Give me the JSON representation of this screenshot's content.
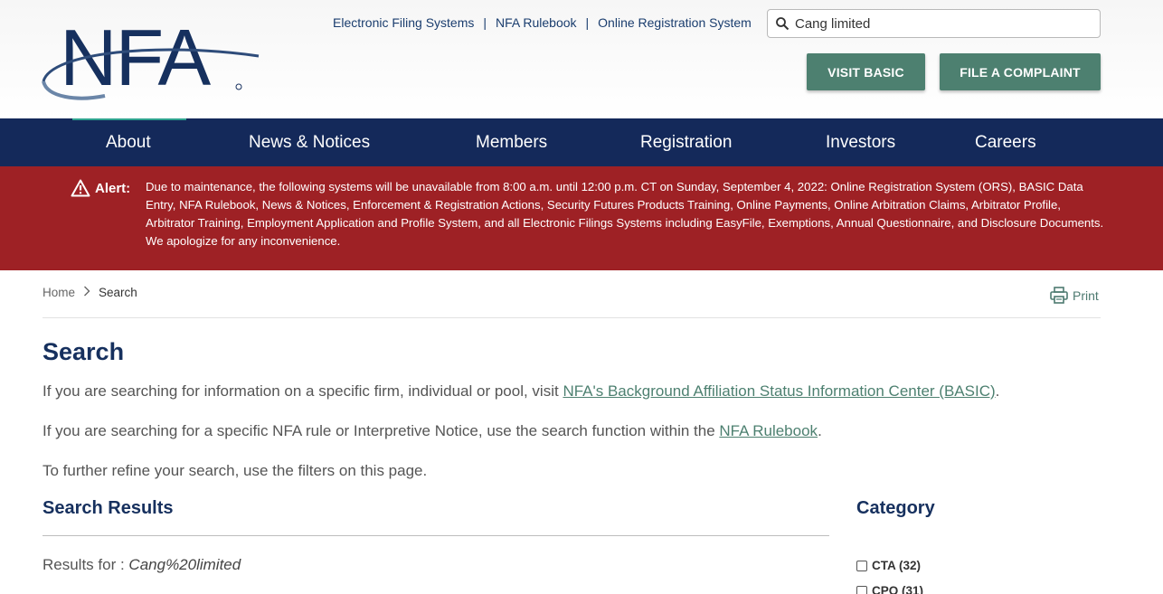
{
  "header": {
    "logo_text": "NFA",
    "top_links": [
      "Electronic Filing Systems",
      "NFA Rulebook",
      "Online Registration System"
    ],
    "search_value": "Cang limited",
    "visit_basic_label": "VISIT BASIC",
    "file_complaint_label": "FILE A COMPLAINT"
  },
  "nav": {
    "items": [
      "About",
      "News & Notices",
      "Members",
      "Registration",
      "Investors",
      "Careers"
    ]
  },
  "alert": {
    "label": "Alert:",
    "message": "Due to maintenance, the following systems will be unavailable from 8:00 a.m. until 12:00 p.m. CT on Sunday, September 4, 2022: Online Registration System (ORS), BASIC Data Entry, NFA Rulebook, News & Notices, Enforcement & Registration Actions, Security Futures Products Training, Online Payments, Online Arbitration Claims, Arbitrator Profile, Arbitrator Training, Employment Application and Profile System, and all Electronic Filings Systems including EasyFile, Exemptions, Annual Questionnaire, and Disclosure Documents. We apologize for any inconvenience."
  },
  "breadcrumb": {
    "home": "Home",
    "current": "Search"
  },
  "print_label": "Print",
  "page": {
    "title": "Search",
    "p1_text": "If you are searching for information on a specific firm, individual or pool, visit ",
    "p1_link": "NFA's Background Affiliation Status Information Center (BASIC)",
    "p1_end": ".",
    "p2_text": "If you are searching for a specific NFA rule or Interpretive Notice, use the search function within the ",
    "p2_link": "NFA Rulebook",
    "p2_end": ".",
    "p3_text": "To further refine your search, use the filters on this page."
  },
  "results": {
    "heading": "Search Results",
    "label": "Results for : ",
    "query": "Cang%20limited"
  },
  "category": {
    "heading": "Category",
    "items": [
      {
        "label": "CTA (32)"
      },
      {
        "label": "CPO (31)"
      }
    ]
  },
  "colors": {
    "navy": "#14295a",
    "alert_red": "#9e2125",
    "green": "#4d8070"
  }
}
